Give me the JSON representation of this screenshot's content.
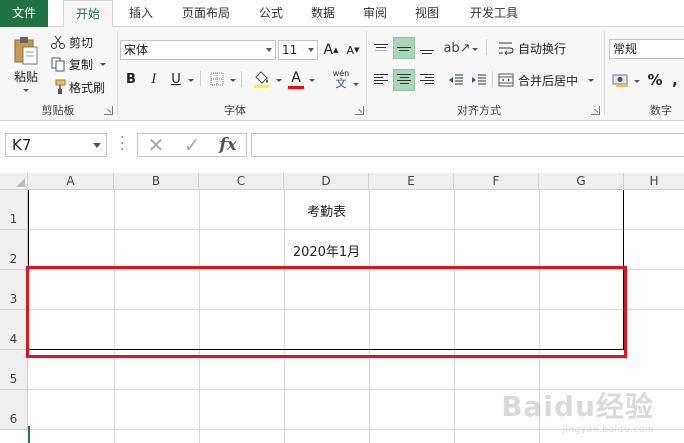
{
  "tabs": [
    {
      "label": "文件"
    },
    {
      "label": "开始"
    },
    {
      "label": "插入"
    },
    {
      "label": "页面布局"
    },
    {
      "label": "公式"
    },
    {
      "label": "数据"
    },
    {
      "label": "审阅"
    },
    {
      "label": "视图"
    },
    {
      "label": "开发工具"
    }
  ],
  "clipboard": {
    "paste": "粘贴",
    "cut": "剪切",
    "copy": "复制",
    "format_painter": "格式刷",
    "label": "剪贴板"
  },
  "font": {
    "name": "宋体",
    "size": "11",
    "grow": "A",
    "shrink": "A",
    "bold": "B",
    "italic": "I",
    "underline": "U",
    "font_color_glyph": "A",
    "phonetic_top": "wén",
    "phonetic_bottom": "文",
    "label": "字体"
  },
  "alignment": {
    "wrap_text": "自动换行",
    "merge_center": "合并后居中",
    "label": "对齐方式"
  },
  "number": {
    "format": "常规",
    "percent": "%",
    "comma": ",",
    "label": "数字"
  },
  "formula_bar": {
    "name_box": "K7",
    "cancel": "✕",
    "enter": "✓",
    "fx": "fx",
    "value": ""
  },
  "sheet": {
    "columns": [
      "A",
      "B",
      "C",
      "D",
      "E",
      "F",
      "G",
      "H"
    ],
    "rows": [
      "1",
      "2",
      "3",
      "4",
      "5",
      "6"
    ],
    "cells": {
      "D1": "考勤表",
      "D2": "2020年1月"
    }
  },
  "watermark": {
    "brand": "Baidu经验",
    "url": "jingyan.baidu.com"
  },
  "colors": {
    "excel_green": "#217346",
    "highlight_red": "#e0141e",
    "selected_button": "#a9d5b9"
  }
}
